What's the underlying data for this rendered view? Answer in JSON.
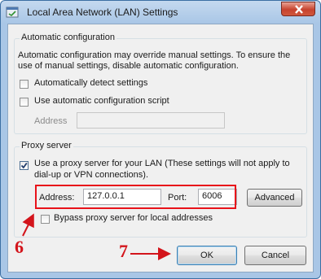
{
  "window": {
    "title": "Local Area Network (LAN) Settings"
  },
  "auto_config": {
    "title": "Automatic configuration",
    "description_line1": "Automatic configuration may override manual settings.  To ensure the",
    "description_line2": "use of manual settings, disable automatic configuration.",
    "detect_label": "Automatically detect settings",
    "detect_checked": false,
    "script_label": "Use automatic configuration script",
    "script_checked": false,
    "address_label": "Address",
    "address_value": ""
  },
  "proxy": {
    "title": "Proxy server",
    "use_proxy_label_line1": "Use a proxy server for your LAN (These settings will not apply to",
    "use_proxy_label_line2": "dial-up or VPN connections).",
    "use_proxy_checked": true,
    "address_label": "Address:",
    "address_value": "127.0.0.1",
    "port_label": "Port:",
    "port_value": "6006",
    "advanced_label": "Advanced",
    "bypass_label": "Bypass proxy server for local addresses",
    "bypass_checked": false
  },
  "buttons": {
    "ok_label": "OK",
    "cancel_label": "Cancel"
  },
  "annotations": {
    "step6": "6",
    "step7": "7",
    "color": "#d3141b"
  }
}
